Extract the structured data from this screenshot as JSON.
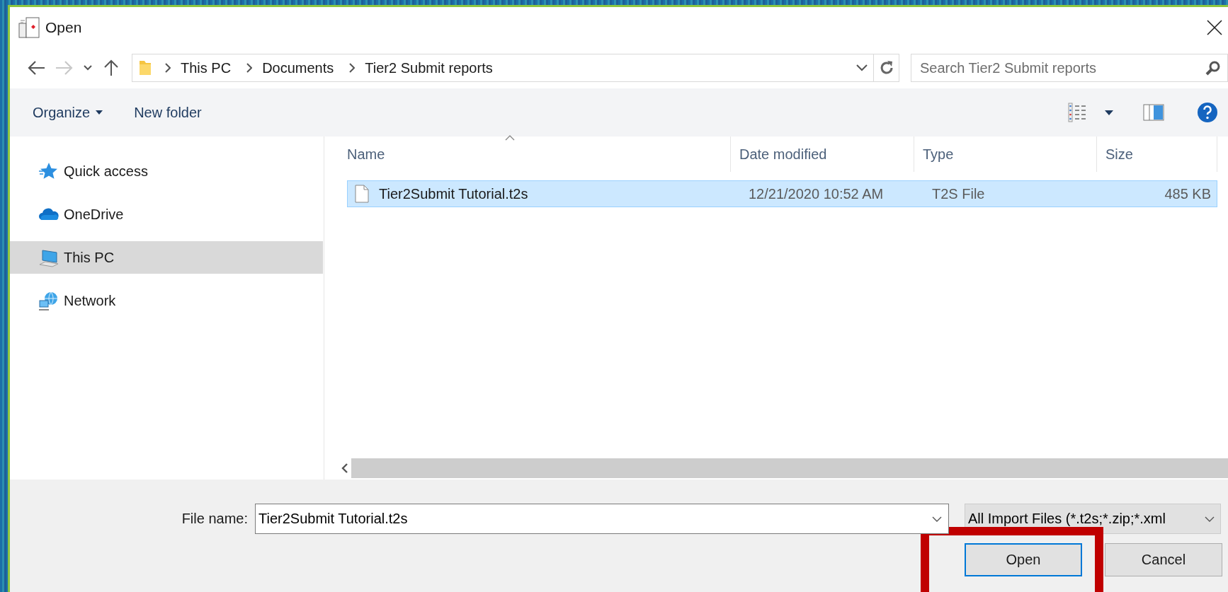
{
  "window": {
    "title": "Open"
  },
  "address_bar": {
    "breadcrumbs": [
      "This PC",
      "Documents",
      "Tier2 Submit reports"
    ]
  },
  "search": {
    "placeholder": "Search Tier2 Submit reports"
  },
  "toolbar": {
    "organize": "Organize",
    "new_folder": "New folder"
  },
  "sidebar": {
    "items": [
      {
        "label": "Quick access",
        "kind": "star",
        "selected": false
      },
      {
        "label": "OneDrive",
        "kind": "cloud",
        "selected": false
      },
      {
        "label": "This PC",
        "kind": "computer",
        "selected": true
      },
      {
        "label": "Network",
        "kind": "network",
        "selected": false
      }
    ]
  },
  "file_list": {
    "columns": [
      {
        "label": "Name",
        "sorted": true
      },
      {
        "label": "Date modified",
        "sorted": false
      },
      {
        "label": "Type",
        "sorted": false
      },
      {
        "label": "Size",
        "sorted": false
      }
    ],
    "rows": [
      {
        "cells": [
          "Tier2Submit Tutorial.t2s",
          "12/21/2020 10:52 AM",
          "T2S File",
          "485 KB"
        ],
        "selected": true
      }
    ]
  },
  "file_name": {
    "label": "File name:",
    "value": "Tier2Submit Tutorial.t2s"
  },
  "file_type": {
    "value": "All Import Files (*.t2s;*.zip;*.xml"
  },
  "buttons": [
    {
      "label": "Open",
      "kind": "default",
      "highlighted": true
    },
    {
      "label": "Cancel",
      "kind": "normal",
      "highlighted": false
    }
  ]
}
